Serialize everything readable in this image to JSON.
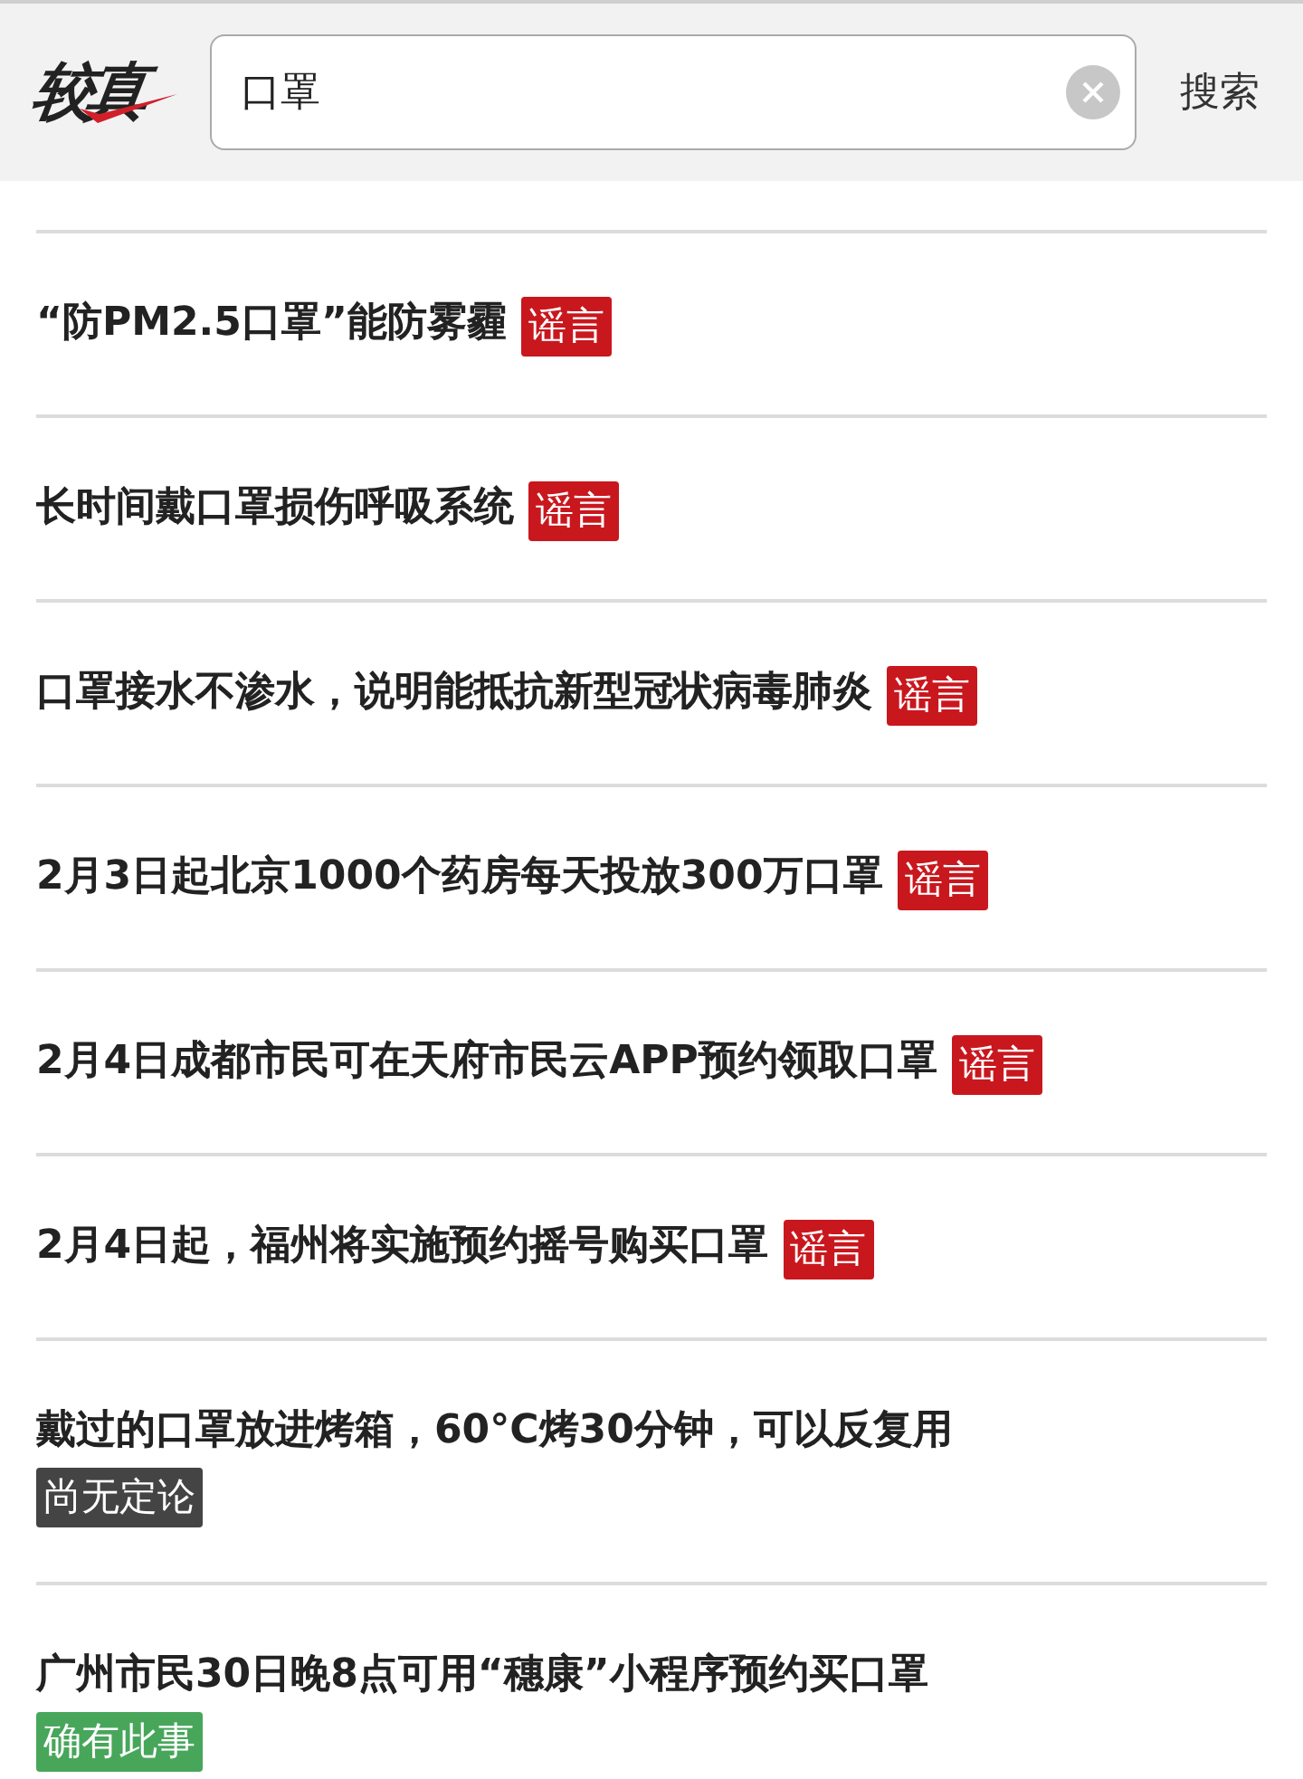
{
  "header": {
    "logo": "较真",
    "search": {
      "value": "口罩"
    },
    "search_button": "搜索"
  },
  "results": [
    {
      "title": "“防PM2.5口罩”能防雾霾",
      "verdict": {
        "kind": "rumor",
        "label": "谣言"
      }
    },
    {
      "title": "长时间戴口罩损伤呼吸系统",
      "verdict": {
        "kind": "rumor",
        "label": "谣言"
      }
    },
    {
      "title": "口罩接水不渗水，说明能抵抗新型冠状病毒肺炎",
      "verdict": {
        "kind": "rumor",
        "label": "谣言"
      }
    },
    {
      "title": "2月3日起北京1000个药房每天投放300万口罩",
      "verdict": {
        "kind": "rumor",
        "label": "谣言"
      }
    },
    {
      "title": "2月4日成都市民可在天府市民云APP预约领取口罩",
      "verdict": {
        "kind": "rumor",
        "label": "谣言"
      }
    },
    {
      "title": "2月4日起，福州将实施预约摇号购买口罩",
      "verdict": {
        "kind": "rumor",
        "label": "谣言"
      }
    },
    {
      "title": "戴过的口罩放进烤箱，60°C烤30分钟，可以反复用",
      "verdict": {
        "kind": "unsettled",
        "label": "尚无定论"
      }
    },
    {
      "title": "广州市民30日晚8点可用“穗康”小程序预约买口罩",
      "verdict": {
        "kind": "true",
        "label": "确有此事"
      }
    }
  ]
}
